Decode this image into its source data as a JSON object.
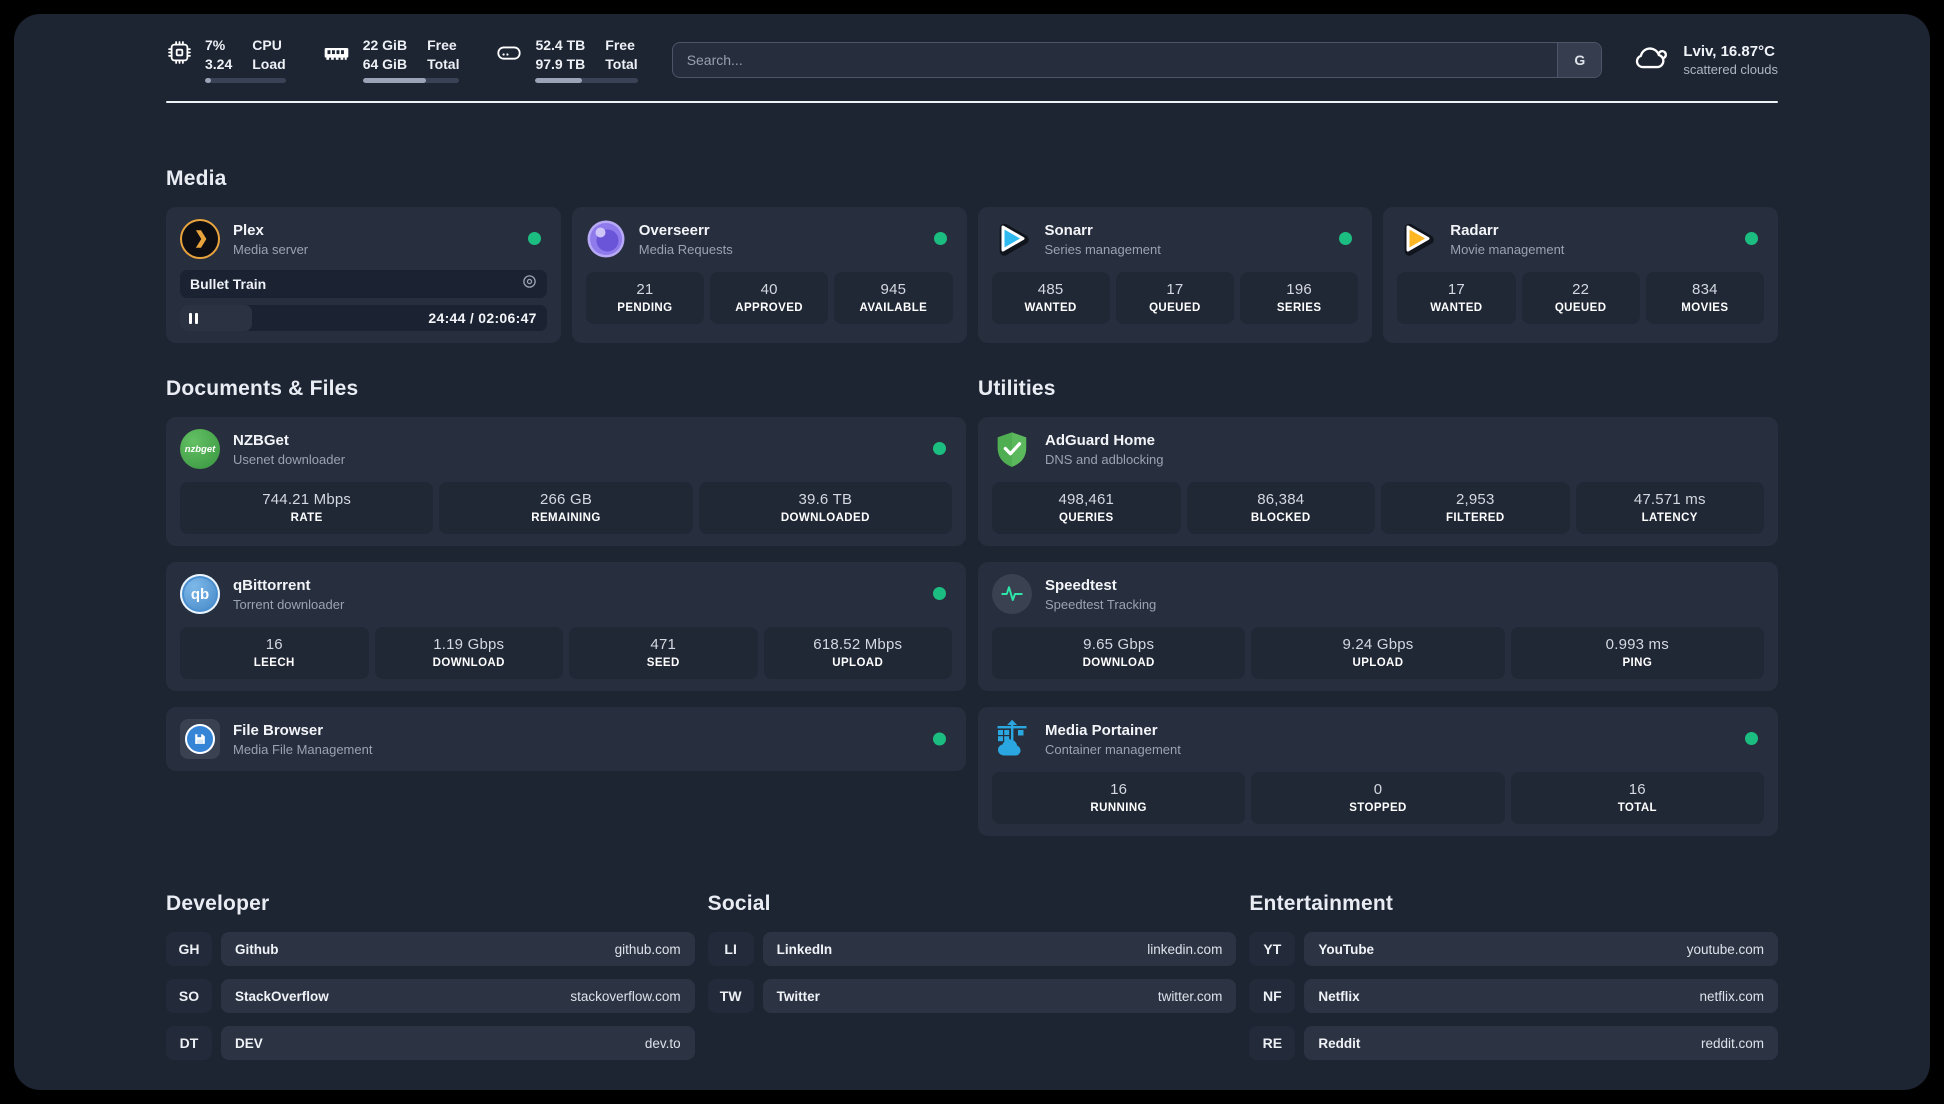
{
  "header": {
    "stats": [
      {
        "id": "cpu",
        "value_top": "7%",
        "value_bottom": "3.24",
        "label_top": "CPU",
        "label_bottom": "Load",
        "progress_pct": 8
      },
      {
        "id": "memory",
        "value_top": "22 GiB",
        "value_bottom": "64 GiB",
        "label_top": "Free",
        "label_bottom": "Total",
        "progress_pct": 65
      },
      {
        "id": "disk",
        "value_top": "52.4 TB",
        "value_bottom": "97.9 TB",
        "label_top": "Free",
        "label_bottom": "Total",
        "progress_pct": 46
      }
    ],
    "search": {
      "placeholder": "Search...",
      "engine_button_label": "G"
    },
    "weather": {
      "summary": "Lviv, 16.87°C",
      "condition": "scattered clouds"
    }
  },
  "sections": {
    "media": {
      "title": "Media",
      "plex": {
        "name": "Plex",
        "description": "Media server",
        "online": true,
        "now_playing": {
          "title": "Bullet Train",
          "time": "24:44 / 02:06:47",
          "progress_pct": 19.5
        }
      },
      "overseerr": {
        "name": "Overseerr",
        "description": "Media Requests",
        "online": true,
        "stats": [
          {
            "value": "21",
            "label": "PENDING"
          },
          {
            "value": "40",
            "label": "APPROVED"
          },
          {
            "value": "945",
            "label": "AVAILABLE"
          }
        ]
      },
      "sonarr": {
        "name": "Sonarr",
        "description": "Series management",
        "online": true,
        "stats": [
          {
            "value": "485",
            "label": "WANTED"
          },
          {
            "value": "17",
            "label": "QUEUED"
          },
          {
            "value": "196",
            "label": "SERIES"
          }
        ]
      },
      "radarr": {
        "name": "Radarr",
        "description": "Movie management",
        "online": true,
        "stats": [
          {
            "value": "17",
            "label": "WANTED"
          },
          {
            "value": "22",
            "label": "QUEUED"
          },
          {
            "value": "834",
            "label": "MOVIES"
          }
        ]
      }
    },
    "documents": {
      "title": "Documents & Files",
      "nzbget": {
        "name": "NZBGet",
        "description": "Usenet downloader",
        "online": true,
        "icon_text": "nzbget",
        "stats": [
          {
            "value": "744.21 Mbps",
            "label": "RATE"
          },
          {
            "value": "266 GB",
            "label": "REMAINING"
          },
          {
            "value": "39.6 TB",
            "label": "DOWNLOADED"
          }
        ]
      },
      "qbittorrent": {
        "name": "qBittorrent",
        "description": "Torrent downloader",
        "online": true,
        "icon_text": "qb",
        "stats": [
          {
            "value": "16",
            "label": "LEECH"
          },
          {
            "value": "1.19 Gbps",
            "label": "DOWNLOAD"
          },
          {
            "value": "471",
            "label": "SEED"
          },
          {
            "value": "618.52 Mbps",
            "label": "UPLOAD"
          }
        ]
      },
      "filebrowser": {
        "name": "File Browser",
        "description": "Media File Management",
        "online": true
      }
    },
    "utilities": {
      "title": "Utilities",
      "adguard": {
        "name": "AdGuard Home",
        "description": "DNS and adblocking",
        "stats": [
          {
            "value": "498,461",
            "label": "QUERIES"
          },
          {
            "value": "86,384",
            "label": "BLOCKED"
          },
          {
            "value": "2,953",
            "label": "FILTERED"
          },
          {
            "value": "47.571 ms",
            "label": "LATENCY"
          }
        ]
      },
      "speedtest": {
        "name": "Speedtest",
        "description": "Speedtest Tracking",
        "stats": [
          {
            "value": "9.65 Gbps",
            "label": "DOWNLOAD"
          },
          {
            "value": "9.24 Gbps",
            "label": "UPLOAD"
          },
          {
            "value": "0.993 ms",
            "label": "PING"
          }
        ]
      },
      "portainer": {
        "name": "Media Portainer",
        "description": "Container management",
        "online": true,
        "stats": [
          {
            "value": "16",
            "label": "RUNNING"
          },
          {
            "value": "0",
            "label": "STOPPED"
          },
          {
            "value": "16",
            "label": "TOTAL"
          }
        ]
      }
    },
    "links": {
      "developer": {
        "title": "Developer",
        "items": [
          {
            "abbr": "GH",
            "name": "Github",
            "url": "github.com"
          },
          {
            "abbr": "SO",
            "name": "StackOverflow",
            "url": "stackoverflow.com"
          },
          {
            "abbr": "DT",
            "name": "DEV",
            "url": "dev.to"
          }
        ]
      },
      "social": {
        "title": "Social",
        "items": [
          {
            "abbr": "LI",
            "name": "LinkedIn",
            "url": "linkedin.com"
          },
          {
            "abbr": "TW",
            "name": "Twitter",
            "url": "twitter.com"
          }
        ]
      },
      "entertainment": {
        "title": "Entertainment",
        "items": [
          {
            "abbr": "YT",
            "name": "YouTube",
            "url": "youtube.com"
          },
          {
            "abbr": "NF",
            "name": "Netflix",
            "url": "netflix.com"
          },
          {
            "abbr": "RE",
            "name": "Reddit",
            "url": "reddit.com"
          }
        ]
      }
    }
  },
  "colors": {
    "online_dot": "#1cbd80",
    "plex_gold": "#e8a33d",
    "sonarr_blue": "#2fb9ef",
    "radarr_yellow": "#ffb623",
    "adguard_green": "#5cb85c",
    "nzbget_green": "#37953f",
    "qbittorrent_blue": "#3e82c4",
    "overseerr_purple": "#8f7bec",
    "speedtest_pulse": "#2ee6a8",
    "portainer_blue": "#2aa7e0"
  }
}
